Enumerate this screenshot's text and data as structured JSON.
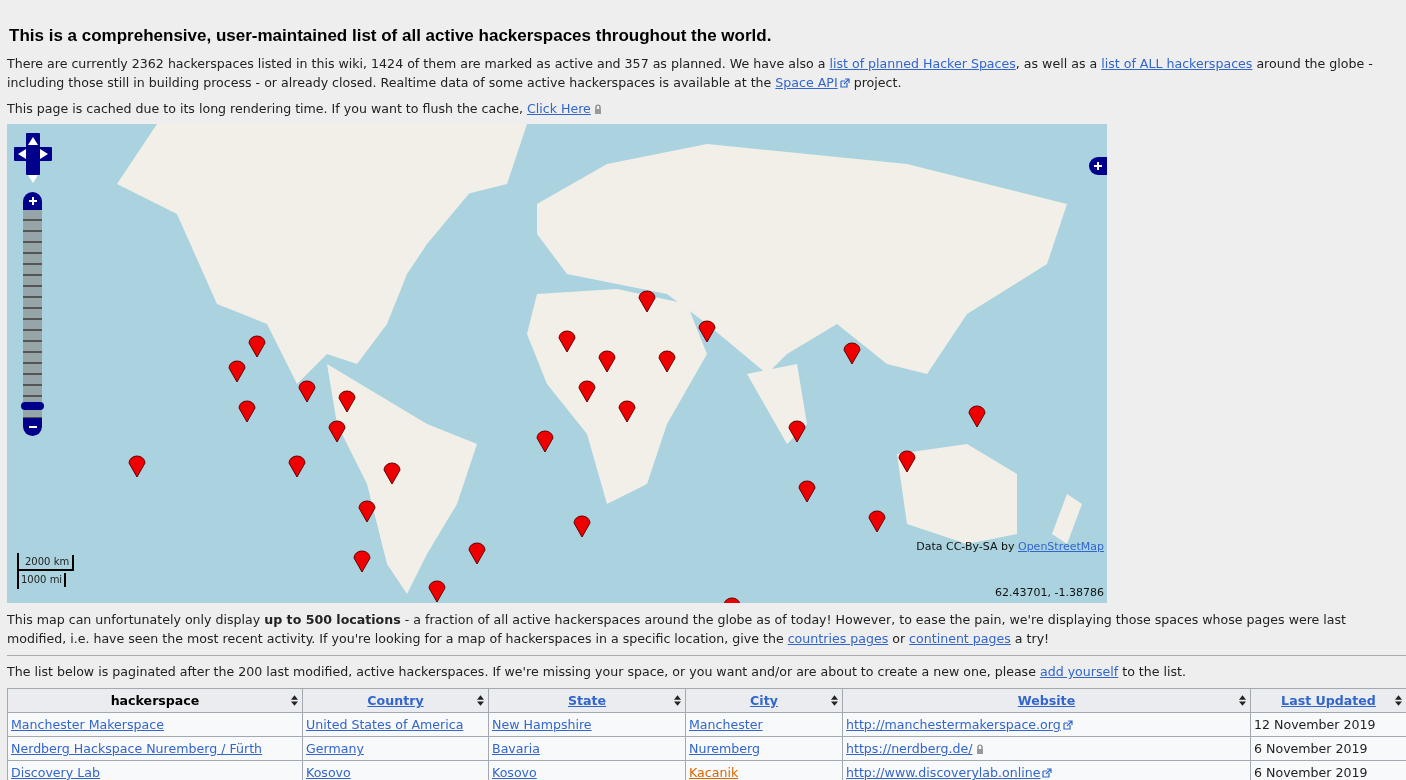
{
  "heading": "This is a comprehensive, user-maintained list of all active hackerspaces throughout the world.",
  "intro": [
    [
      {
        "text": "There are currently 2362 hackerspaces listed in this wiki, 1424 of them are marked as active and 357 as planned. We have also a "
      },
      {
        "text": "list of planned Hacker Spaces",
        "kind": "link"
      },
      {
        "text": ", as well as a "
      },
      {
        "text": "list of ALL hackerspaces",
        "kind": "link"
      },
      {
        "text": " around the globe - including those still in building process - or already closed. Realtime data of some active hackerspaces is available at the "
      },
      {
        "text": "Space API",
        "kind": "extlink"
      },
      {
        "text": " project."
      }
    ],
    [
      {
        "text": "This page is cached due to its long rendering time. If you want to flush the cache, "
      },
      {
        "text": "Click Here",
        "kind": "locklink"
      }
    ]
  ],
  "map": {
    "zoom": {
      "level": 0.06
    },
    "scale_km": "2000 km",
    "scale_mi": "1000 mi",
    "attribution": [
      {
        "text": "Data CC-By-SA by "
      },
      {
        "text": "OpenStreetMap",
        "kind": "link"
      }
    ],
    "coordinates": "62.43701, -1.38786"
  },
  "notes": [
    [
      {
        "text": "This map can unfortunately only display "
      },
      {
        "text": "up to 500 locations",
        "kind": "bold"
      },
      {
        "text": " - a fraction of all active hackerspaces around the globe as of today! However, to ease the pain, we're displaying those spaces whose pages were last modified, i.e. have seen the most recent activity. If you're looking for a map of hackerspaces in a specific location, give the "
      },
      {
        "text": "countries pages",
        "kind": "link"
      },
      {
        "text": " or "
      },
      {
        "text": "continent pages",
        "kind": "link"
      },
      {
        "text": " a try!"
      }
    ]
  ],
  "list_intro": [
    {
      "text": "The list below is paginated after the 200 last modified, active hackerspaces. If we're missing your space, or you want and/or are about to create a new one, please "
    },
    {
      "text": "add yourself",
      "kind": "link"
    },
    {
      "text": " to the list."
    }
  ],
  "table": {
    "columns": [
      {
        "label": "hackerspace",
        "kind": "text"
      },
      {
        "label": "Country",
        "kind": "link"
      },
      {
        "label": "State",
        "kind": "link"
      },
      {
        "label": "City",
        "kind": "link"
      },
      {
        "label": "Website",
        "kind": "link"
      },
      {
        "label": "Last Updated",
        "kind": "link"
      }
    ],
    "rows": [
      [
        {
          "text": "Manchester Makerspace",
          "kind": "link"
        },
        {
          "text": "United States of America",
          "kind": "link"
        },
        {
          "text": "New Hampshire",
          "kind": "link"
        },
        {
          "text": "Manchester",
          "kind": "link"
        },
        {
          "text": "http://manchestermakerspace.org",
          "kind": "extlink"
        },
        {
          "text": "12 November 2019",
          "kind": "text"
        }
      ],
      [
        {
          "text": "Nerdberg Hackspace Nuremberg / Fürth",
          "kind": "link"
        },
        {
          "text": "Germany",
          "kind": "link"
        },
        {
          "text": "Bavaria",
          "kind": "link"
        },
        {
          "text": "Nuremberg",
          "kind": "link"
        },
        {
          "text": "https://nerdberg.de/",
          "kind": "locklink"
        },
        {
          "text": "6 November 2019",
          "kind": "text"
        }
      ],
      [
        {
          "text": "Discovery Lab",
          "kind": "link"
        },
        {
          "text": "Kosovo",
          "kind": "link"
        },
        {
          "text": "Kosovo",
          "kind": "link"
        },
        {
          "text": "Kacanik",
          "kind": "newlink"
        },
        {
          "text": "http://www.discoverylab.online",
          "kind": "extlink"
        },
        {
          "text": "6 November 2019",
          "kind": "text"
        }
      ]
    ]
  }
}
